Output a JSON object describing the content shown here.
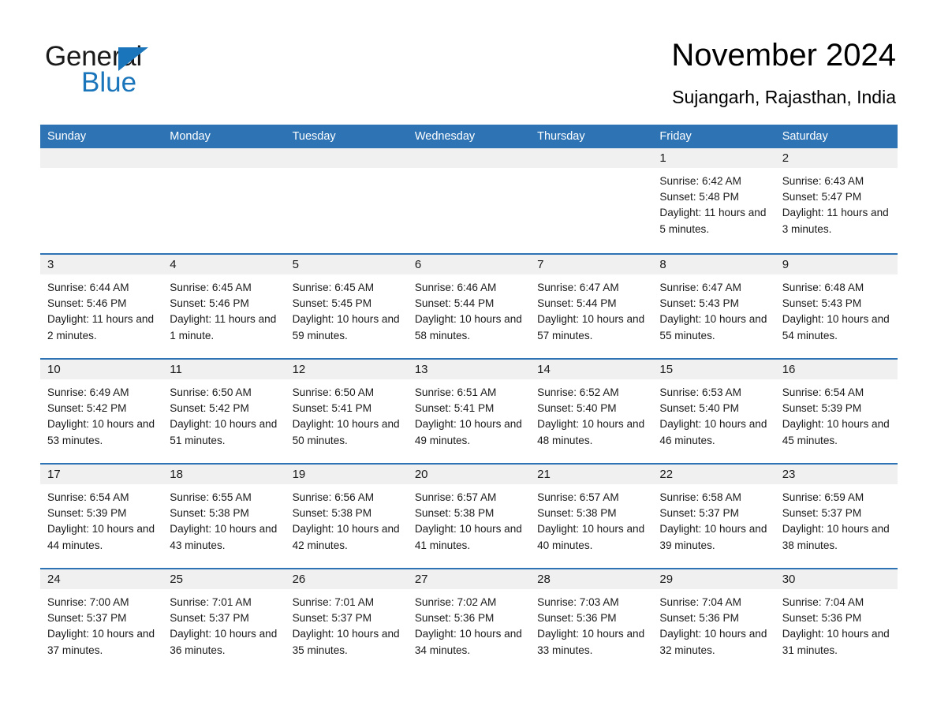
{
  "brand": {
    "name_part1": "General",
    "name_part2": "Blue",
    "accent_color": "#1b75bb",
    "triangle_icon": "triangle-right-icon"
  },
  "header": {
    "title": "November 2024",
    "subtitle": "Sujangarh, Rajasthan, India"
  },
  "colors": {
    "header_blue": "#2e74b5",
    "row_divider_blue": "#2e74b5",
    "daynum_band_gray": "#f0f0f0",
    "text": "#1a1a1a",
    "page_background": "#ffffff"
  },
  "weekday_headers": [
    "Sunday",
    "Monday",
    "Tuesday",
    "Wednesday",
    "Thursday",
    "Friday",
    "Saturday"
  ],
  "weeks": [
    [
      {
        "day": "",
        "sunrise": "",
        "sunset": "",
        "daylight": ""
      },
      {
        "day": "",
        "sunrise": "",
        "sunset": "",
        "daylight": ""
      },
      {
        "day": "",
        "sunrise": "",
        "sunset": "",
        "daylight": ""
      },
      {
        "day": "",
        "sunrise": "",
        "sunset": "",
        "daylight": ""
      },
      {
        "day": "",
        "sunrise": "",
        "sunset": "",
        "daylight": ""
      },
      {
        "day": "1",
        "sunrise": "Sunrise: 6:42 AM",
        "sunset": "Sunset: 5:48 PM",
        "daylight": "Daylight: 11 hours and 5 minutes."
      },
      {
        "day": "2",
        "sunrise": "Sunrise: 6:43 AM",
        "sunset": "Sunset: 5:47 PM",
        "daylight": "Daylight: 11 hours and 3 minutes."
      }
    ],
    [
      {
        "day": "3",
        "sunrise": "Sunrise: 6:44 AM",
        "sunset": "Sunset: 5:46 PM",
        "daylight": "Daylight: 11 hours and 2 minutes."
      },
      {
        "day": "4",
        "sunrise": "Sunrise: 6:45 AM",
        "sunset": "Sunset: 5:46 PM",
        "daylight": "Daylight: 11 hours and 1 minute."
      },
      {
        "day": "5",
        "sunrise": "Sunrise: 6:45 AM",
        "sunset": "Sunset: 5:45 PM",
        "daylight": "Daylight: 10 hours and 59 minutes."
      },
      {
        "day": "6",
        "sunrise": "Sunrise: 6:46 AM",
        "sunset": "Sunset: 5:44 PM",
        "daylight": "Daylight: 10 hours and 58 minutes."
      },
      {
        "day": "7",
        "sunrise": "Sunrise: 6:47 AM",
        "sunset": "Sunset: 5:44 PM",
        "daylight": "Daylight: 10 hours and 57 minutes."
      },
      {
        "day": "8",
        "sunrise": "Sunrise: 6:47 AM",
        "sunset": "Sunset: 5:43 PM",
        "daylight": "Daylight: 10 hours and 55 minutes."
      },
      {
        "day": "9",
        "sunrise": "Sunrise: 6:48 AM",
        "sunset": "Sunset: 5:43 PM",
        "daylight": "Daylight: 10 hours and 54 minutes."
      }
    ],
    [
      {
        "day": "10",
        "sunrise": "Sunrise: 6:49 AM",
        "sunset": "Sunset: 5:42 PM",
        "daylight": "Daylight: 10 hours and 53 minutes."
      },
      {
        "day": "11",
        "sunrise": "Sunrise: 6:50 AM",
        "sunset": "Sunset: 5:42 PM",
        "daylight": "Daylight: 10 hours and 51 minutes."
      },
      {
        "day": "12",
        "sunrise": "Sunrise: 6:50 AM",
        "sunset": "Sunset: 5:41 PM",
        "daylight": "Daylight: 10 hours and 50 minutes."
      },
      {
        "day": "13",
        "sunrise": "Sunrise: 6:51 AM",
        "sunset": "Sunset: 5:41 PM",
        "daylight": "Daylight: 10 hours and 49 minutes."
      },
      {
        "day": "14",
        "sunrise": "Sunrise: 6:52 AM",
        "sunset": "Sunset: 5:40 PM",
        "daylight": "Daylight: 10 hours and 48 minutes."
      },
      {
        "day": "15",
        "sunrise": "Sunrise: 6:53 AM",
        "sunset": "Sunset: 5:40 PM",
        "daylight": "Daylight: 10 hours and 46 minutes."
      },
      {
        "day": "16",
        "sunrise": "Sunrise: 6:54 AM",
        "sunset": "Sunset: 5:39 PM",
        "daylight": "Daylight: 10 hours and 45 minutes."
      }
    ],
    [
      {
        "day": "17",
        "sunrise": "Sunrise: 6:54 AM",
        "sunset": "Sunset: 5:39 PM",
        "daylight": "Daylight: 10 hours and 44 minutes."
      },
      {
        "day": "18",
        "sunrise": "Sunrise: 6:55 AM",
        "sunset": "Sunset: 5:38 PM",
        "daylight": "Daylight: 10 hours and 43 minutes."
      },
      {
        "day": "19",
        "sunrise": "Sunrise: 6:56 AM",
        "sunset": "Sunset: 5:38 PM",
        "daylight": "Daylight: 10 hours and 42 minutes."
      },
      {
        "day": "20",
        "sunrise": "Sunrise: 6:57 AM",
        "sunset": "Sunset: 5:38 PM",
        "daylight": "Daylight: 10 hours and 41 minutes."
      },
      {
        "day": "21",
        "sunrise": "Sunrise: 6:57 AM",
        "sunset": "Sunset: 5:38 PM",
        "daylight": "Daylight: 10 hours and 40 minutes."
      },
      {
        "day": "22",
        "sunrise": "Sunrise: 6:58 AM",
        "sunset": "Sunset: 5:37 PM",
        "daylight": "Daylight: 10 hours and 39 minutes."
      },
      {
        "day": "23",
        "sunrise": "Sunrise: 6:59 AM",
        "sunset": "Sunset: 5:37 PM",
        "daylight": "Daylight: 10 hours and 38 minutes."
      }
    ],
    [
      {
        "day": "24",
        "sunrise": "Sunrise: 7:00 AM",
        "sunset": "Sunset: 5:37 PM",
        "daylight": "Daylight: 10 hours and 37 minutes."
      },
      {
        "day": "25",
        "sunrise": "Sunrise: 7:01 AM",
        "sunset": "Sunset: 5:37 PM",
        "daylight": "Daylight: 10 hours and 36 minutes."
      },
      {
        "day": "26",
        "sunrise": "Sunrise: 7:01 AM",
        "sunset": "Sunset: 5:37 PM",
        "daylight": "Daylight: 10 hours and 35 minutes."
      },
      {
        "day": "27",
        "sunrise": "Sunrise: 7:02 AM",
        "sunset": "Sunset: 5:36 PM",
        "daylight": "Daylight: 10 hours and 34 minutes."
      },
      {
        "day": "28",
        "sunrise": "Sunrise: 7:03 AM",
        "sunset": "Sunset: 5:36 PM",
        "daylight": "Daylight: 10 hours and 33 minutes."
      },
      {
        "day": "29",
        "sunrise": "Sunrise: 7:04 AM",
        "sunset": "Sunset: 5:36 PM",
        "daylight": "Daylight: 10 hours and 32 minutes."
      },
      {
        "day": "30",
        "sunrise": "Sunrise: 7:04 AM",
        "sunset": "Sunset: 5:36 PM",
        "daylight": "Daylight: 10 hours and 31 minutes."
      }
    ]
  ]
}
